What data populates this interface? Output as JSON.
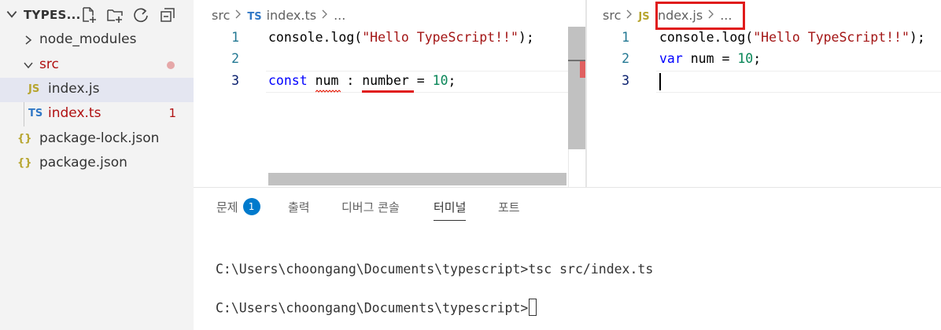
{
  "explorer": {
    "title": "TYPES...",
    "tree": [
      {
        "label": "node_modules",
        "icon": "chevron-right-icon"
      },
      {
        "label": "src",
        "icon": "chevron-down-icon",
        "color": "#b01011"
      },
      {
        "label": "index.js",
        "icon": "JS"
      },
      {
        "label": "index.ts",
        "icon": "TS",
        "problems": "1"
      },
      {
        "label": "package-lock.json",
        "icon": "{}"
      },
      {
        "label": "package.json",
        "icon": "{}"
      }
    ]
  },
  "editor_left": {
    "breadcrumb": {
      "folder": "src",
      "file_icon": "TS",
      "file": "index.ts",
      "more": "..."
    },
    "lines": [
      "1",
      "2",
      "3"
    ],
    "code": {
      "l1_fn": "console.log(",
      "l1_str": "\"Hello TypeScript!!\"",
      "l1_end": ");",
      "l3_kw": "const",
      "l3_var": "num",
      "l3_colon": " : ",
      "l3_type": "number",
      "l3_eq": " = ",
      "l3_num": "10",
      "l3_end": ";"
    }
  },
  "editor_right": {
    "breadcrumb": {
      "folder": "src",
      "file_icon": "JS",
      "file": "index.js",
      "more": "..."
    },
    "lines": [
      "1",
      "2",
      "3"
    ],
    "code": {
      "l1_fn": "console.log(",
      "l1_str": "\"Hello TypeScript!!\"",
      "l1_end": ");",
      "l2_kw": "var",
      "l2_mid": " num = ",
      "l2_num": "10",
      "l2_end": ";"
    }
  },
  "panel": {
    "tabs": [
      {
        "label": "문제",
        "badge": "1"
      },
      {
        "label": "출력"
      },
      {
        "label": "디버그 콘솔"
      },
      {
        "label": "터미널",
        "active": true
      },
      {
        "label": "포트"
      }
    ],
    "terminal": [
      "C:\\Users\\choongang\\Documents\\typescript>tsc src/index.ts",
      "C:\\Users\\choongang\\Documents\\typescript>"
    ]
  },
  "colors": {
    "accent": "#007acc",
    "error": "#e01b1b",
    "keyword": "#0000ff",
    "string": "#a31515",
    "number": "#098658"
  }
}
